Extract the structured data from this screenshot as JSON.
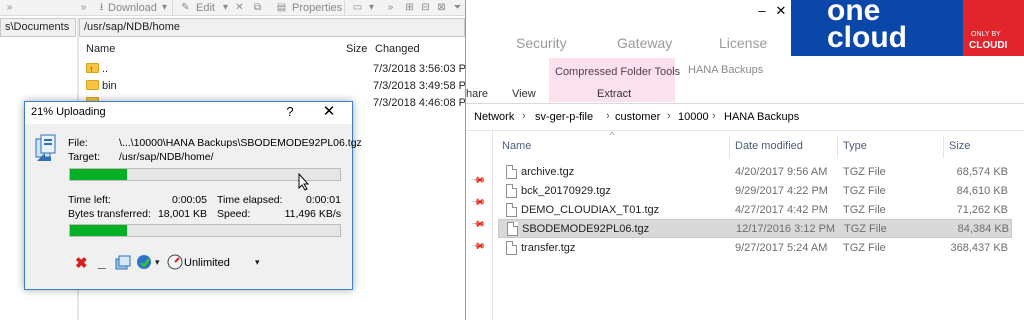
{
  "winscp": {
    "toolbar": {
      "download_label": "Download",
      "edit_label": "Edit",
      "properties_label": "Properties"
    },
    "left_path": "s\\Documents",
    "remote_path": "/usr/sap/NDB/home",
    "columns": {
      "name": "Name",
      "size": "Size",
      "changed": "Changed"
    },
    "files": [
      {
        "name": "..",
        "changed": "7/3/2018 3:56:03 PI"
      },
      {
        "name": "bin",
        "changed": "7/3/2018 3:49:58 PI"
      },
      {
        "name": "",
        "changed": "7/3/2018 4:46:08 PI"
      }
    ]
  },
  "upload_dialog": {
    "title": "21% Uploading",
    "help": "?",
    "close": "✕",
    "file_label": "File:",
    "file_value": "\\...\\10000\\HANA Backups\\SBODEMODE92PL06.tgz",
    "target_label": "Target:",
    "target_value": "/usr/sap/NDB/home/",
    "file_progress": 0.21,
    "time_left_label": "Time left:",
    "time_left": "0:00:05",
    "time_elapsed_label": "Time elapsed:",
    "time_elapsed": "0:00:01",
    "bytes_label": "Bytes transferred:",
    "bytes": "18,001 KB",
    "speed_label": "Speed:",
    "speed": "11,496 KB/s",
    "total_progress": 0.21,
    "speed_limit": "Unlimited"
  },
  "explorer": {
    "ribbon_tabs": [
      "Security",
      "Gateway",
      "License"
    ],
    "contextual_group": "Compressed Folder Tools",
    "hana_tab": "HANA Backups",
    "share_tab": "hare",
    "view_tab": "View",
    "extract_tab": "Extract",
    "breadcrumb": [
      "Network",
      "sv-ger-p-file",
      "customer",
      "10000",
      "HANA Backups"
    ],
    "banner": {
      "line1": "one",
      "line2": "cloud",
      "small": "ONLY BY",
      "brand": "CLOUDI"
    },
    "columns": {
      "name": "Name",
      "date": "Date modified",
      "type": "Type",
      "size": "Size"
    },
    "files": [
      {
        "name": "archive.tgz",
        "date": "4/20/2017 9:56 AM",
        "type": "TGZ File",
        "size": "68,574 KB"
      },
      {
        "name": "bck_20170929.tgz",
        "date": "9/29/2017 4:22 PM",
        "type": "TGZ File",
        "size": "84,610 KB"
      },
      {
        "name": "DEMO_CLOUDIAX_T01.tgz",
        "date": "4/27/2017 4:42 PM",
        "type": "TGZ File",
        "size": "71,262 KB"
      },
      {
        "name": "SBODEMODE92PL06.tgz",
        "date": "12/17/2016 3:12 PM",
        "type": "TGZ File",
        "size": "84,384 KB"
      },
      {
        "name": "transfer.tgz",
        "date": "9/27/2017 5:24 AM",
        "type": "TGZ File",
        "size": "368,437 KB"
      }
    ]
  },
  "colors": {
    "progress_green": "#06b025",
    "banner_blue": "#0a47a9",
    "banner_red": "#e2242c",
    "contextual_pink": "#fbe0ee"
  }
}
